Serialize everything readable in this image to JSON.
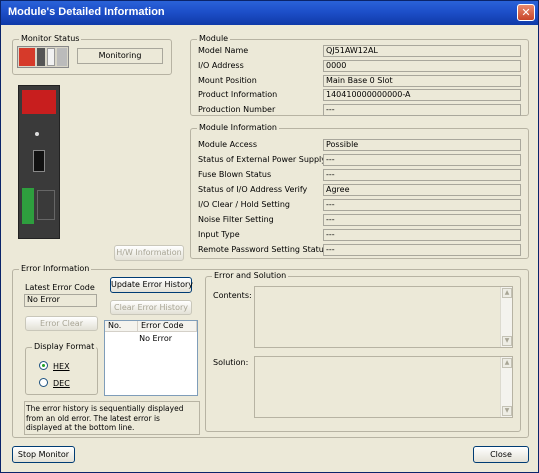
{
  "window": {
    "title": "Module's Detailed Information"
  },
  "monitor_status": {
    "group_label": "Monitor Status",
    "state_text": "Monitoring"
  },
  "module": {
    "group_label": "Module",
    "fields": [
      {
        "label": "Model Name",
        "value": "QJ51AW12AL"
      },
      {
        "label": "I/O Address",
        "value": "0000"
      },
      {
        "label": "Mount Position",
        "value": "Main Base  0 Slot"
      },
      {
        "label": "Product Information",
        "value": "140410000000000-A"
      },
      {
        "label": "Production Number",
        "value": "---"
      }
    ]
  },
  "module_information": {
    "group_label": "Module Information",
    "fields": [
      {
        "label": "Module Access",
        "value": "Possible"
      },
      {
        "label": "Status of External Power Supply",
        "value": "---"
      },
      {
        "label": "Fuse Blown Status",
        "value": "---"
      },
      {
        "label": "Status of I/O Address Verify",
        "value": "Agree"
      },
      {
        "label": "I/O Clear / Hold Setting",
        "value": "---"
      },
      {
        "label": "Noise Filter Setting",
        "value": "---"
      },
      {
        "label": "Input Type",
        "value": "---"
      },
      {
        "label": "Remote Password Setting Status",
        "value": "---"
      }
    ]
  },
  "hw_information_button": "H/W Information",
  "error_information": {
    "group_label": "Error Information",
    "latest_error_code_label": "Latest Error Code",
    "latest_error_code_value": "No Error",
    "update_error_history_button": "Update Error History",
    "clear_error_history_button": "Clear Error History",
    "error_clear_button": "Error Clear",
    "display_format": {
      "group_label": "Display Format",
      "options": [
        {
          "label": "HEX",
          "selected": true
        },
        {
          "label": "DEC",
          "selected": false
        }
      ]
    },
    "history_table": {
      "columns": [
        "No.",
        "Error Code"
      ],
      "rows": [
        {
          "no": "",
          "error_code": "No Error"
        }
      ]
    },
    "note": "The error history is sequentially displayed from an old error. The latest error is displayed at the bottom line."
  },
  "error_and_solution": {
    "group_label": "Error and Solution",
    "contents_label": "Contents:",
    "solution_label": "Solution:"
  },
  "footer": {
    "stop_monitor_button": "Stop Monitor",
    "close_button": "Close"
  },
  "colors": {
    "titlebar": "#1d4fc9",
    "window_bg": "#ece9d8",
    "close": "#c8452a"
  }
}
